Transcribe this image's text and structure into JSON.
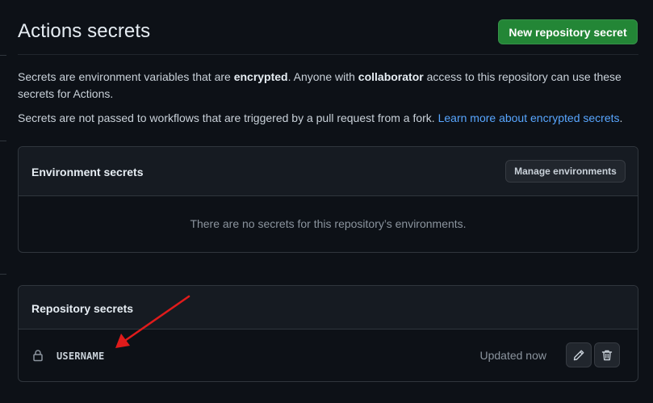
{
  "header": {
    "title": "Actions secrets",
    "new_secret_label": "New repository secret"
  },
  "description": {
    "line1_a": "Secrets are environment variables that are ",
    "line1_b": "encrypted",
    "line1_c": ". Anyone with ",
    "line1_d": "collaborator",
    "line1_e": " access to this repository can use these secrets for Actions.",
    "line2_a": "Secrets are not passed to workflows that are triggered by a pull request from a fork. ",
    "line2_link": "Learn more about encrypted secrets",
    "line2_end": "."
  },
  "environment_secrets": {
    "title": "Environment secrets",
    "manage_label": "Manage environments",
    "empty_message": "There are no secrets for this repository’s environments."
  },
  "repository_secrets": {
    "title": "Repository secrets",
    "items": [
      {
        "name": "USERNAME",
        "updated": "Updated now",
        "icon": "lock-icon"
      }
    ]
  },
  "colors": {
    "background": "#0d1117",
    "primary_button": "#238636",
    "link": "#58a6ff",
    "annotation_arrow": "#e01b1b"
  }
}
